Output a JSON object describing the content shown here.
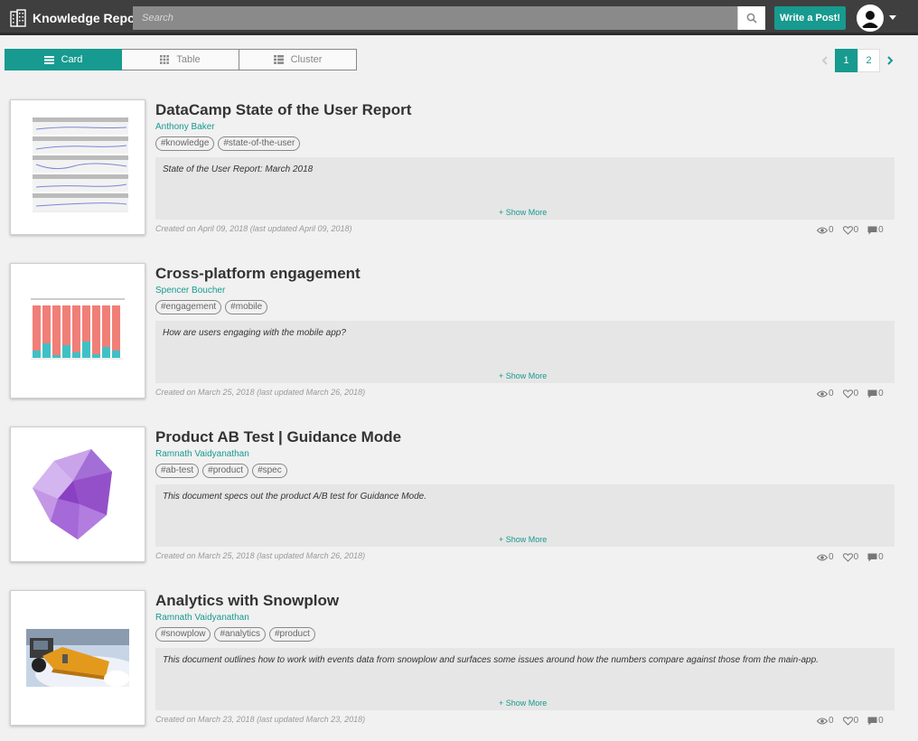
{
  "app": {
    "title": "Knowledge Repo",
    "search_placeholder": "Search",
    "write_label": "Write a Post!"
  },
  "views": [
    {
      "label": "Card",
      "icon": "list-icon",
      "active": true
    },
    {
      "label": "Table",
      "icon": "grid-icon",
      "active": false
    },
    {
      "label": "Cluster",
      "icon": "cluster-icon",
      "active": false
    }
  ],
  "pagination": {
    "pages": [
      "1",
      "2"
    ],
    "current": "1"
  },
  "show_more_label": "+ Show More",
  "posts": [
    {
      "title": "DataCamp State of the User Report",
      "author": "Anthony Baker",
      "tags": [
        "#knowledge",
        "#state-of-the-user"
      ],
      "excerpt": "State of the User Report: March 2018",
      "meta": "Created on April 09, 2018 (last updated April 09, 2018)",
      "views": "0",
      "likes": "0",
      "comments": "0"
    },
    {
      "title": "Cross-platform engagement",
      "author": "Spencer Boucher",
      "tags": [
        "#engagement",
        "#mobile"
      ],
      "excerpt": "How are users engaging with the mobile app?",
      "meta": "Created on March 25, 2018 (last updated March 26, 2018)",
      "views": "0",
      "likes": "0",
      "comments": "0"
    },
    {
      "title": "Product AB Test | Guidance Mode",
      "author": "Ramnath Vaidyanathan",
      "tags": [
        "#ab-test",
        "#product",
        "#spec"
      ],
      "excerpt": "This document specs out the product A/B test for Guidance Mode.",
      "meta": "Created on March 25, 2018 (last updated March 26, 2018)",
      "views": "0",
      "likes": "0",
      "comments": "0"
    },
    {
      "title": "Analytics with Snowplow",
      "author": "Ramnath Vaidyanathan",
      "tags": [
        "#snowplow",
        "#analytics",
        "#product"
      ],
      "excerpt": "This document outlines how to work with events data from snowplow and surfaces some issues around how the numbers compare against those from the main-app.",
      "meta": "Created on March 23, 2018 (last updated March 23, 2018)",
      "views": "0",
      "likes": "0",
      "comments": "0"
    }
  ],
  "colors": {
    "accent": "#179a8f",
    "topbar": "#3f3f3f"
  }
}
